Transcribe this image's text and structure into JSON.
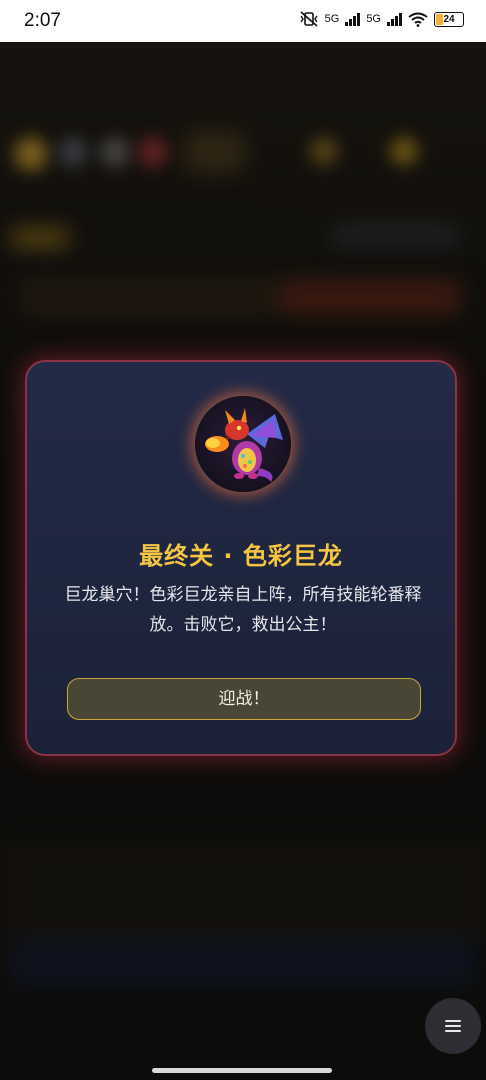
{
  "status_bar": {
    "time": "2:07",
    "network_1": "5G",
    "network_2": "5G",
    "battery_level": "24"
  },
  "modal": {
    "title": "最终关 · 色彩巨龙",
    "description": "巨龙巢穴！色彩巨龙亲自上阵，所有技能轮番释放。击败它，救出公主！",
    "button_label": "迎战！",
    "accent_color": "#f5c542",
    "border_color": "#8a3346"
  },
  "icons": {
    "avatar": "dragon-icon",
    "menu": "hamburger-menu-icon"
  }
}
